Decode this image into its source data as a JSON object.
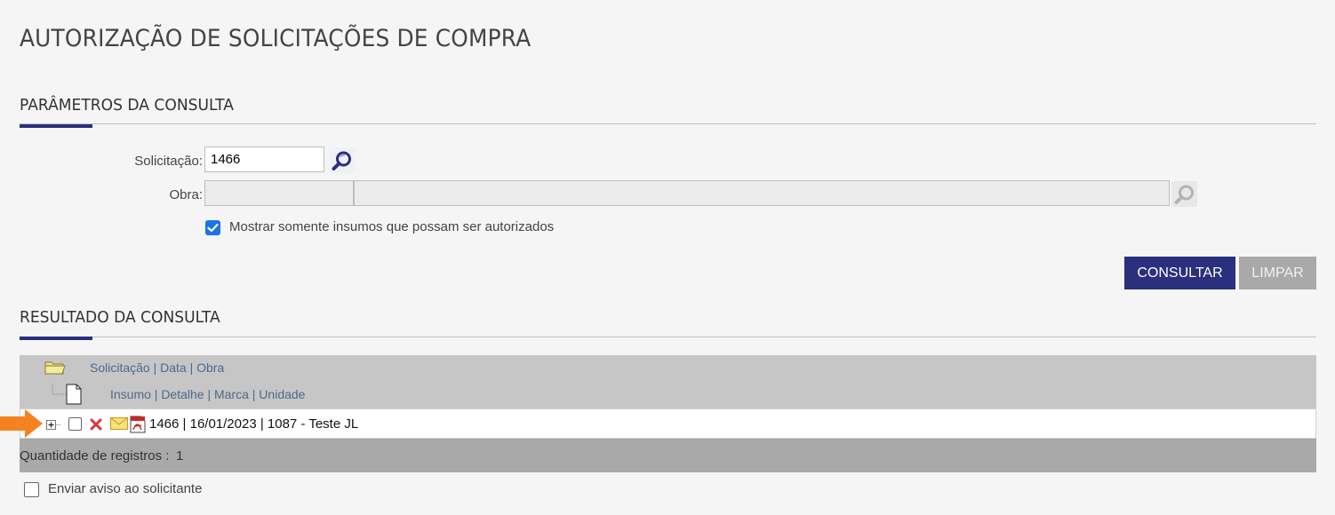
{
  "page": {
    "title": "AUTORIZAÇÃO DE SOLICITAÇÕES DE COMPRA"
  },
  "params": {
    "section_title": "PARÂMETROS DA CONSULTA",
    "solicitacao_label": "Solicitação:",
    "solicitacao_value": "1466",
    "obra_label": "Obra:",
    "obra_code_value": "",
    "obra_name_value": "",
    "only_authorizable_label": "Mostrar somente insumos que possam ser autorizados",
    "only_authorizable_checked": true,
    "consultar_label": "CONSULTAR",
    "limpar_label": "LIMPAR"
  },
  "results": {
    "section_title": "RESULTADO DA CONSULTA",
    "header_level1": "Solicitação | Data | Obra",
    "header_level2": "Insumo | Detalhe | Marca | Unidade",
    "rows": [
      {
        "text": "1466 | 16/01/2023 | 1087 - Teste JL"
      }
    ],
    "count_label": "Quantidade de registros :",
    "count_value": "1",
    "notify_label": "Enviar aviso ao solicitante",
    "notify_checked": false
  },
  "colors": {
    "accent": "#2a2f7e",
    "arrow": "#f58220",
    "delete_icon": "#d8343b",
    "mail_icon": "#f2c84b",
    "checkbox_checked": "#1a73e8"
  },
  "icons": {
    "solicitacao_search": "search-icon",
    "obra_search": "search-icon",
    "folder": "folder-icon",
    "document": "document-icon",
    "expand": "plus-box-icon",
    "delete": "close-icon",
    "mail": "mail-icon",
    "pdf": "pdf-icon",
    "pointer": "arrow-right-icon"
  }
}
